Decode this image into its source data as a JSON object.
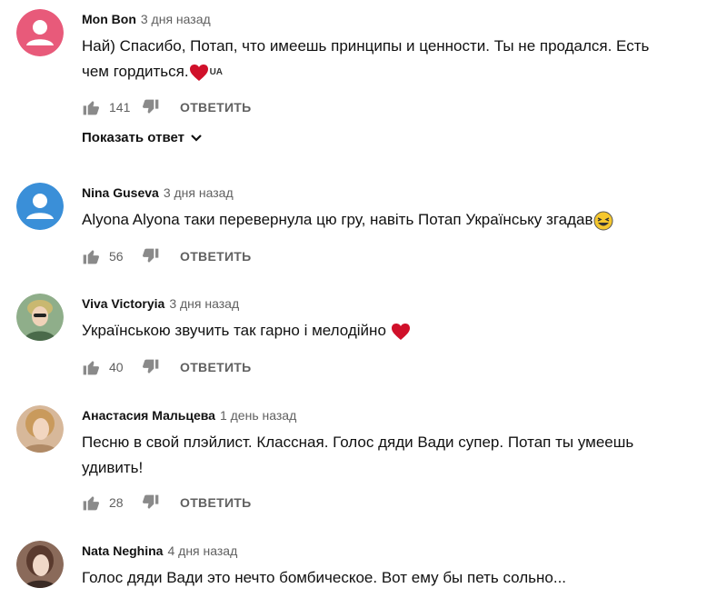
{
  "comments": [
    {
      "author": "Mon Bon",
      "time": "3 дня назад",
      "text_lines": [
        "Най) Спасибо, Потап, что имеешь принципы и ценности. Ты не продался. Есть",
        "чем гордиться."
      ],
      "flag_label": "UA",
      "likes": "141",
      "reply": "ОТВЕТИТЬ",
      "show_replies": "Показать ответ",
      "avatar": {
        "type": "default",
        "color": "#e85a7a",
        "icon": "person-silhouette-icon"
      }
    },
    {
      "author": "Nina Guseva",
      "time": "3 дня назад",
      "text": "Alyona Alyona таки перевернула цю гру, навіть Потап Українську згадав",
      "likes": "56",
      "reply": "ОТВЕТИТЬ",
      "avatar": {
        "type": "default",
        "color": "#3a8fd8",
        "icon": "person-silhouette-icon"
      }
    },
    {
      "author": "Viva Victoryia",
      "time": "3 дня назад",
      "text": "Українською звучить так гарно і мелодійно",
      "likes": "40",
      "reply": "ОТВЕТИТЬ",
      "avatar": {
        "type": "photo",
        "color": "#8fae8a"
      }
    },
    {
      "author": "Анастасия Мальцева",
      "time": "1 день назад",
      "text_lines": [
        "Песню в свой плэйлист. Классная. Голос дяди Вади супер. Потап ты умеешь",
        "удивить!"
      ],
      "likes": "28",
      "reply": "ОТВЕТИТЬ",
      "avatar": {
        "type": "photo",
        "color": "#d7b89a"
      }
    },
    {
      "author": "Nata Neghina",
      "time": "4 дня назад",
      "text": "Голос дяди Вади это нечто бомбическое. Вот ему бы петь сольно...",
      "avatar": {
        "type": "photo",
        "color": "#8a6a5a"
      }
    }
  ],
  "icons": {
    "like": "thumb-up-icon",
    "dislike": "thumb-down-icon",
    "heart": "red-heart-emoji",
    "laugh": "grinning-squinting-face-emoji",
    "chevron": "chevron-down-icon"
  },
  "colors": {
    "heart": "#d0102a",
    "meta": "#606060",
    "text": "#111111"
  }
}
